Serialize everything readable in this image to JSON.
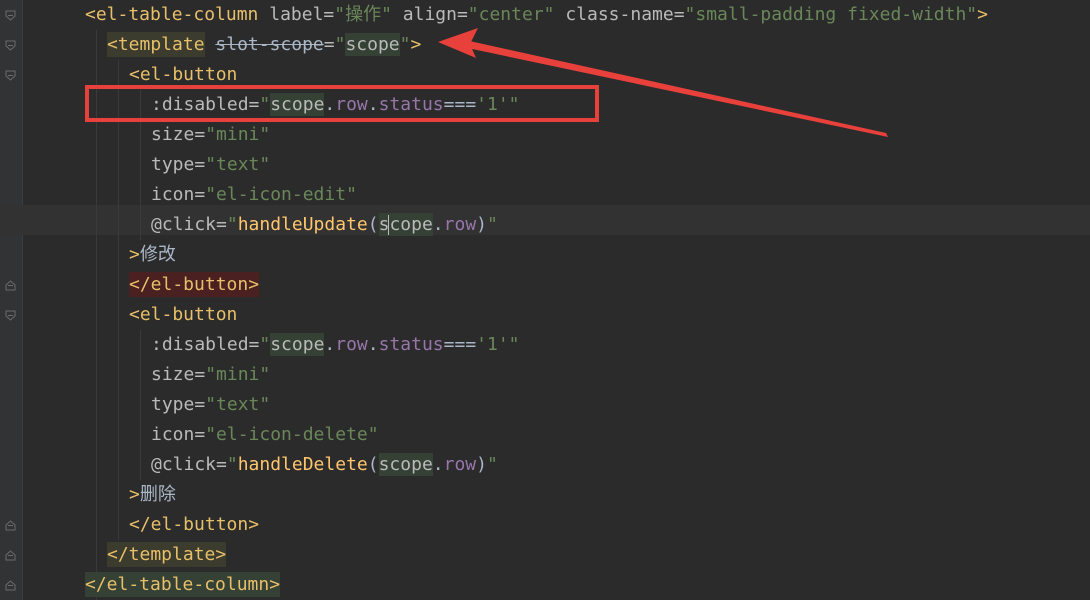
{
  "lines": [
    {
      "id": 0,
      "parts": [
        [
          "tag",
          "<el-table-column"
        ],
        [
          "attr",
          " label="
        ],
        [
          "str",
          "\"操作\""
        ],
        [
          "attr",
          " align="
        ],
        [
          "str",
          "\"center\""
        ],
        [
          "attr",
          " class-name="
        ],
        [
          "str",
          "\"small-padding fixed-width\""
        ],
        [
          "tag",
          ">"
        ]
      ]
    },
    {
      "id": 1,
      "parts": [
        [
          "tag",
          "<template"
        ],
        [
          "punc",
          " "
        ],
        [
          "strike",
          "slot-scope"
        ],
        [
          "attr",
          "="
        ],
        [
          "str",
          "\""
        ],
        [
          "scope",
          "scope"
        ],
        [
          "str",
          "\""
        ],
        [
          "tag",
          ">"
        ]
      ]
    },
    {
      "id": 2,
      "parts": [
        [
          "tag",
          "<el-button"
        ]
      ]
    },
    {
      "id": 3,
      "parts": [
        [
          "attr",
          ":disabled="
        ],
        [
          "str",
          "\""
        ],
        [
          "scope",
          "scope"
        ],
        [
          "punc",
          "."
        ],
        [
          "prop",
          "row"
        ],
        [
          "punc",
          "."
        ],
        [
          "prop",
          "status"
        ],
        [
          "punc",
          "==="
        ],
        [
          "str",
          "'1'"
        ],
        [
          "str",
          "\""
        ]
      ]
    },
    {
      "id": 4,
      "parts": [
        [
          "attr",
          "size="
        ],
        [
          "str",
          "\"mini\""
        ]
      ]
    },
    {
      "id": 5,
      "parts": [
        [
          "attr",
          "type="
        ],
        [
          "str",
          "\"text\""
        ]
      ]
    },
    {
      "id": 6,
      "parts": [
        [
          "attr",
          "icon="
        ],
        [
          "str",
          "\"el-icon-edit\""
        ]
      ]
    },
    {
      "id": 7,
      "parts": [
        [
          "attr",
          "@click="
        ],
        [
          "str",
          "\""
        ],
        [
          "fn",
          "handleUpdate"
        ],
        [
          "punc",
          "("
        ],
        [
          "scope",
          "s"
        ],
        [
          "caret",
          ""
        ],
        [
          "scope",
          "cope"
        ],
        [
          "punc",
          "."
        ],
        [
          "prop",
          "row"
        ],
        [
          "punc",
          ")"
        ],
        [
          "str",
          "\""
        ]
      ]
    },
    {
      "id": 8,
      "parts": [
        [
          "tag",
          ">"
        ],
        [
          "punc",
          "修改"
        ]
      ]
    },
    {
      "id": 9,
      "parts": [
        [
          "end",
          "</el-button>"
        ]
      ]
    },
    {
      "id": 10,
      "parts": [
        [
          "tag",
          "<el-button"
        ]
      ]
    },
    {
      "id": 11,
      "parts": [
        [
          "attr",
          ":disabled="
        ],
        [
          "str",
          "\""
        ],
        [
          "scope",
          "scope"
        ],
        [
          "punc",
          "."
        ],
        [
          "prop",
          "row"
        ],
        [
          "punc",
          "."
        ],
        [
          "prop",
          "status"
        ],
        [
          "punc",
          "==="
        ],
        [
          "str",
          "'1'"
        ],
        [
          "str",
          "\""
        ]
      ]
    },
    {
      "id": 12,
      "parts": [
        [
          "attr",
          "size="
        ],
        [
          "str",
          "\"mini\""
        ]
      ]
    },
    {
      "id": 13,
      "parts": [
        [
          "attr",
          "type="
        ],
        [
          "str",
          "\"text\""
        ]
      ]
    },
    {
      "id": 14,
      "parts": [
        [
          "attr",
          "icon="
        ],
        [
          "str",
          "\"el-icon-delete\""
        ]
      ]
    },
    {
      "id": 15,
      "parts": [
        [
          "attr",
          "@click="
        ],
        [
          "str",
          "\""
        ],
        [
          "fn",
          "handleDelete"
        ],
        [
          "punc",
          "("
        ],
        [
          "scope",
          "scope"
        ],
        [
          "punc",
          "."
        ],
        [
          "prop",
          "row"
        ],
        [
          "punc",
          ")"
        ],
        [
          "str",
          "\""
        ]
      ]
    },
    {
      "id": 16,
      "parts": [
        [
          "tag",
          ">"
        ],
        [
          "punc",
          "删除"
        ]
      ]
    },
    {
      "id": 17,
      "parts": [
        [
          "tag",
          "</el-button>"
        ]
      ]
    },
    {
      "id": 18,
      "parts": [
        [
          "tpl",
          "</template>"
        ]
      ]
    },
    {
      "id": 19,
      "parts": [
        [
          "tagbg",
          "</el-table-column>"
        ]
      ]
    }
  ],
  "annotation": {
    "highlight_color": "#e8413c",
    "highlighted_line": 3,
    "arrow_points_to": "slot-scope"
  },
  "colors": {
    "background": "#2b2b2b",
    "tag": "#e8bf6a",
    "string": "#6a8759",
    "property": "#9876aa",
    "function": "#ffc66d"
  }
}
